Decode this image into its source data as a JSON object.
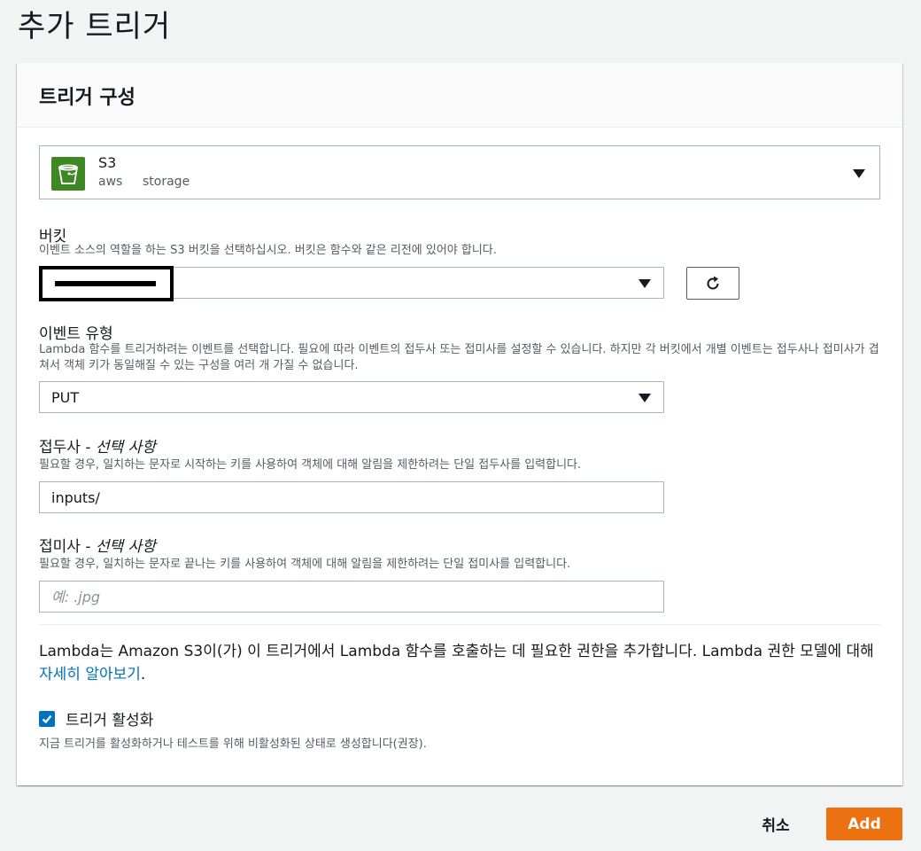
{
  "page": {
    "title": "추가 트리거"
  },
  "card": {
    "title": "트리거 구성"
  },
  "source": {
    "name": "S3",
    "tags": [
      "aws",
      "storage"
    ],
    "icon": "s3-bucket-icon"
  },
  "bucket": {
    "label": "버킷",
    "description": "이벤트 소스의 역할을 하는 S3 버킷을 선택하십시오. 버킷은 함수와 같은 리전에 있어야 합니다.",
    "value": "",
    "refresh_icon": "refresh-icon"
  },
  "event_type": {
    "label": "이벤트 유형",
    "description": "Lambda 함수를 트리거하려는 이벤트를 선택합니다. 필요에 따라 이벤트의 접두사 또는 접미사를 설정할 수 있습니다. 하지만 각 버킷에서 개별 이벤트는 접두사나 접미사가 겹쳐서 객체 키가 동일해질 수 있는 구성을 여러 개 가질 수 없습니다.",
    "value": "PUT"
  },
  "prefix": {
    "label": "접두사 -",
    "optional": "선택 사항",
    "description": "필요할 경우, 일치하는 문자로 시작하는 키를 사용하여 객체에 대해 알림을 제한하려는 단일 접두사를 입력합니다.",
    "value": "inputs/"
  },
  "suffix": {
    "label": "접미사 -",
    "optional": "선택 사항",
    "description": "필요할 경우, 일치하는 문자로 끝나는 키를 사용하여 객체에 대해 알림을 제한하려는 단일 접미사를 입력합니다.",
    "placeholder": "예: .jpg",
    "value": ""
  },
  "permissions": {
    "text_before": "Lambda는 Amazon S3이(가) 이 트리거에서 Lambda 함수를 호출하는 데 필요한 권한을 추가합니다. Lambda 권한 모델에 대해 ",
    "link": "자세히 알아보기",
    "text_after": "."
  },
  "enable": {
    "label": "트리거 활성화",
    "checked": true,
    "description": "지금 트리거를 활성화하거나 테스트를 위해 비활성화된 상태로 생성합니다(권장)."
  },
  "footer": {
    "cancel": "취소",
    "add": "Add"
  },
  "colors": {
    "accent": "#ec7211",
    "link": "#0073bb",
    "s3_green": "#3f8624"
  }
}
